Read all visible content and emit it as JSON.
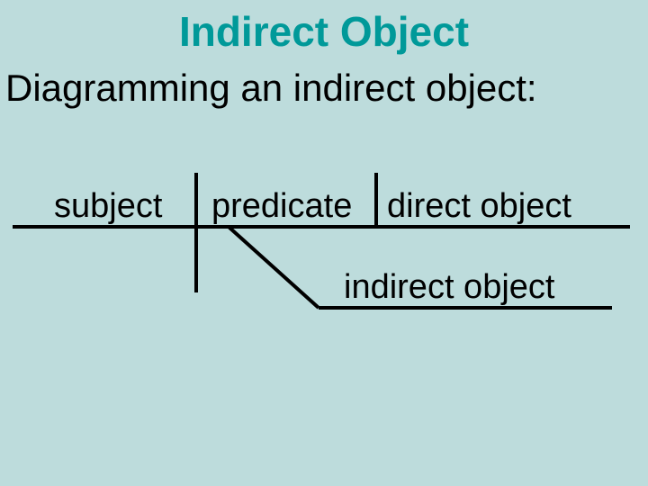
{
  "title": "Indirect Object",
  "subtitle": "Diagramming an indirect object:",
  "labels": {
    "subject": "subject",
    "predicate": "predicate",
    "direct_object": "direct object",
    "indirect_object": "indirect object"
  }
}
